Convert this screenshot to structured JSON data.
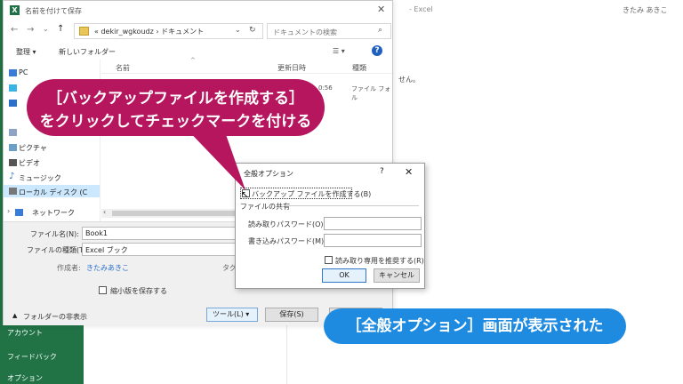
{
  "excel": {
    "title": "- Excel",
    "user": "きたみ あきこ",
    "fragment": "せん。",
    "sidebar": [
      "アカウント",
      "フィードバック",
      "オプション"
    ]
  },
  "save_dialog": {
    "title": "名前を付けて保存",
    "app_icon": "X",
    "address": "« dekir_wgkoudz › ドキュメント",
    "search_placeholder": "ドキュメントの検索",
    "toolbar": {
      "organize": "整理 ▾",
      "new_folder": "新しいフォルダー"
    },
    "nav_items": [
      {
        "label": "PC",
        "icon": "pc-icon"
      },
      {
        "label": "",
        "icon": "folder-3d-icon"
      },
      {
        "label": "",
        "icon": "folder-icon"
      },
      {
        "label": "",
        "icon": "doc-icon"
      },
      {
        "label": "ピクチャ",
        "icon": "picture-icon"
      },
      {
        "label": "ビデオ",
        "icon": "video-icon"
      },
      {
        "label": "ミュージック",
        "icon": "music-icon"
      },
      {
        "label": "ローカル ディスク (C",
        "icon": "disk-icon"
      },
      {
        "label": "ネットワーク",
        "icon": "network-icon"
      }
    ],
    "columns": {
      "name": "名前",
      "date": "更新日時",
      "type": "種類"
    },
    "row": {
      "date": "0:56",
      "type": "ファイル フォル"
    },
    "filename_label": "ファイル名(N):",
    "filename_value": "Book1",
    "filetype_label": "ファイルの種類(T):",
    "filetype_value": "Excel ブック",
    "author_label": "作成者:",
    "author_value": "きたみあきこ",
    "tag_label": "タグ",
    "thumbnail_label": "縮小版を保存する",
    "hide_folders": "フォルダーの非表示",
    "tools_label": "ツール(L)",
    "save_label": "保存(S)"
  },
  "options_dialog": {
    "title": "全般オプション",
    "help": "?",
    "close": "✕",
    "backup_label": "バックアップ ファイルを作成する(B)",
    "sharing_label": "ファイルの共有",
    "read_pw_label": "読み取りパスワード(O):",
    "write_pw_label": "書き込みパスワード(M):",
    "readonly_label": "読み取り専用を推奨する(R)",
    "ok_label": "OK",
    "cancel_label": "キャンセル"
  },
  "callout": {
    "line1": "［バックアップファイルを作成する］",
    "line2": "をクリックしてチェックマークを付ける"
  },
  "caption": "［全般オプション］画面が表示された",
  "colors": {
    "callout": "#b5165e",
    "caption": "#1f8be0",
    "excel_green": "#217346"
  }
}
